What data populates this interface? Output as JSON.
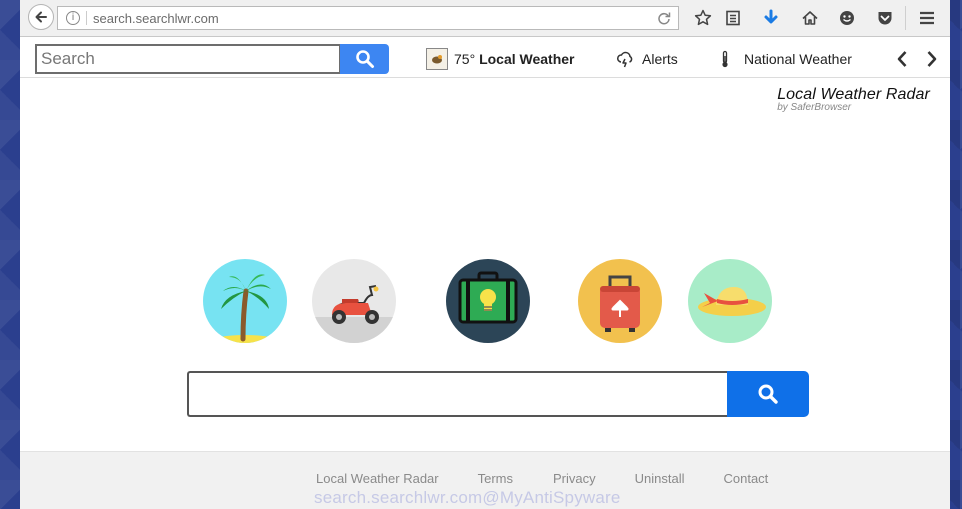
{
  "browser": {
    "url": "search.searchlwr.com"
  },
  "toolbar": {
    "search_placeholder": "Search",
    "temperature": "75°",
    "local_weather_label": "Local Weather",
    "alerts_label": "Alerts",
    "national_weather_label": "National Weather"
  },
  "brand": {
    "title": "Local Weather Radar",
    "subtitle": "by SaferBrowser"
  },
  "footer": {
    "links": [
      "Local Weather Radar",
      "Terms",
      "Privacy",
      "Uninstall",
      "Contact"
    ]
  },
  "watermark": "search.searchlwr.com@MyAntiSpyware",
  "colors": {
    "accent": "#3d86f2",
    "search_button": "#0f70e8",
    "circle_palm": "#77e3f2",
    "circle_scooter": "#e8e8e8",
    "circle_suitcase": "#2c4557",
    "circle_luggage": "#f2c14e",
    "circle_hat": "#a8ecc8"
  },
  "icons": {
    "circles": [
      "palm-tree-icon",
      "scooter-icon",
      "briefcase-lightbulb-icon",
      "luggage-icon",
      "sun-hat-icon"
    ]
  }
}
